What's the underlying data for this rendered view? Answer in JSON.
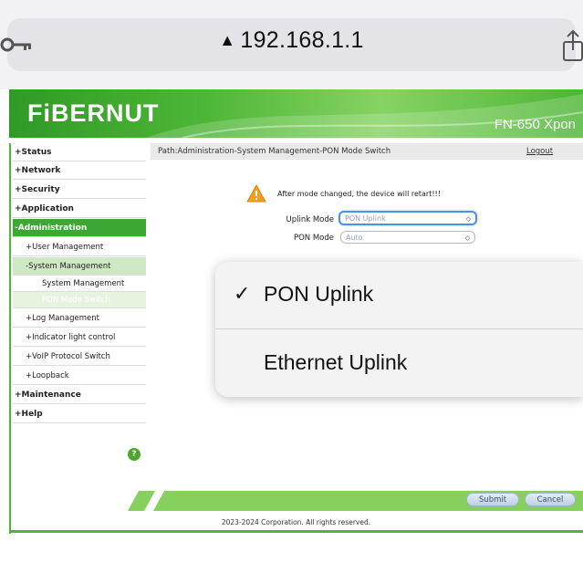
{
  "browser": {
    "url": "192.168.1.1",
    "warning_glyph": "▲"
  },
  "header": {
    "logo": "FiBERNUT",
    "model": "FN-650 Xpon"
  },
  "menu": {
    "items": [
      {
        "label": "+Status"
      },
      {
        "label": "+Network"
      },
      {
        "label": "+Security"
      },
      {
        "label": "+Application"
      },
      {
        "label": "-Administration"
      },
      {
        "label": "+User Management"
      },
      {
        "label": "-System Management"
      },
      {
        "label": "System Management"
      },
      {
        "label": "PON Mode Switch"
      },
      {
        "label": "+Log Management"
      },
      {
        "label": "+Indicator light control"
      },
      {
        "label": "+VoIP Protocol Switch"
      },
      {
        "label": "+Loopback"
      },
      {
        "label": "+Maintenance"
      },
      {
        "label": "+Help"
      }
    ],
    "help_glyph": "?"
  },
  "pathbar": {
    "path": "Path:Administration-System Management-PON Mode Switch",
    "logout": "Logout"
  },
  "form": {
    "warning": "After mode changed, the device will retart!!!",
    "uplink_label": "Uplink Mode",
    "uplink_value": "PON Uplink",
    "pon_label": "PON Mode",
    "pon_value": "Auto",
    "chevron": "◇"
  },
  "dropdown": {
    "check": "✓",
    "options": [
      "PON Uplink",
      "Ethernet Uplink"
    ]
  },
  "footer": {
    "submit": "Submit",
    "cancel": "Cancel",
    "copyright": "2023-2024 Corporation. All rights reserved."
  },
  "colors": {
    "brand_green": "#4fb537",
    "focus_blue": "#4b92e6"
  }
}
